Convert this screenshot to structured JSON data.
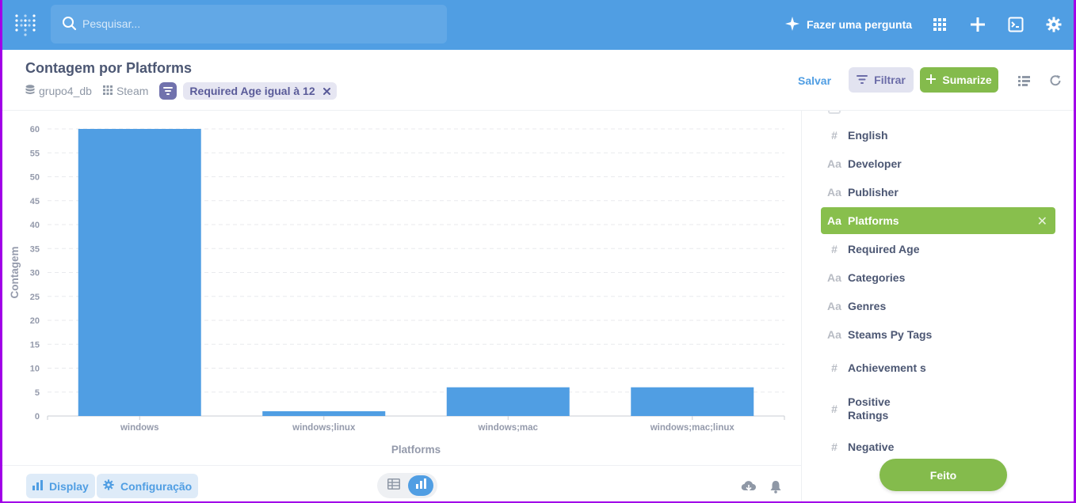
{
  "nav": {
    "search_placeholder": "Pesquisar...",
    "ask_label": "Fazer uma pergunta"
  },
  "header": {
    "title": "Contagem por Platforms",
    "database": "grupo4_db",
    "table": "Steam",
    "filter_pill": "Required Age igual à 12",
    "save_label": "Salvar",
    "filter_label": "Filtrar",
    "summarize_label": "Sumarize"
  },
  "chart_data": {
    "type": "bar",
    "categories": [
      "windows",
      "windows;linux",
      "windows;mac",
      "windows;mac;linux"
    ],
    "values": [
      60,
      1,
      6,
      6
    ],
    "xlabel": "Platforms",
    "ylabel": "Contagem",
    "ylim": [
      0,
      60
    ],
    "yticks": [
      "0",
      "5",
      "10",
      "15",
      "20",
      "25",
      "30",
      "35",
      "40",
      "45",
      "50",
      "55",
      "60"
    ],
    "grid": true,
    "color": "#509ee3"
  },
  "sidebar": {
    "fields": [
      {
        "type": "#",
        "name": "English"
      },
      {
        "type": "Aa",
        "name": "Developer"
      },
      {
        "type": "Aa",
        "name": "Publisher"
      },
      {
        "type": "Aa",
        "name": "Platforms",
        "active": true
      },
      {
        "type": "#",
        "name": "Required Age"
      },
      {
        "type": "Aa",
        "name": "Categories"
      },
      {
        "type": "Aa",
        "name": "Genres"
      },
      {
        "type": "Aa",
        "name": "Steams Py Tags"
      },
      {
        "type": "#",
        "name": "Achievement s"
      },
      {
        "type": "#",
        "name": "Positive Ratings"
      },
      {
        "type": "#",
        "name": "Negative"
      }
    ],
    "done_label": "Feito"
  },
  "footer": {
    "display_label": "Display",
    "settings_label": "Configuração"
  },
  "colors": {
    "brand": "#509ee3",
    "accent_green": "#84bb4c",
    "filter_purple": "#7172ad"
  }
}
